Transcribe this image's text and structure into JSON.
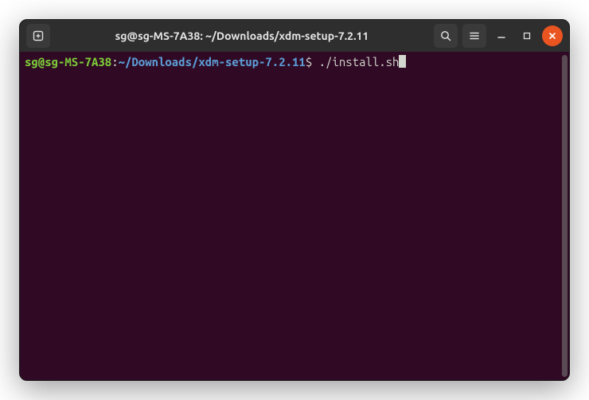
{
  "window": {
    "title": "sg@sg-MS-7A38: ~/Downloads/xdm-setup-7.2.11"
  },
  "prompt": {
    "user_host": "sg@sg-MS-7A38",
    "separator": ":",
    "path": "~/Downloads/xdm-setup-7.2.11",
    "symbol": "$",
    "command": "./install.sh"
  }
}
